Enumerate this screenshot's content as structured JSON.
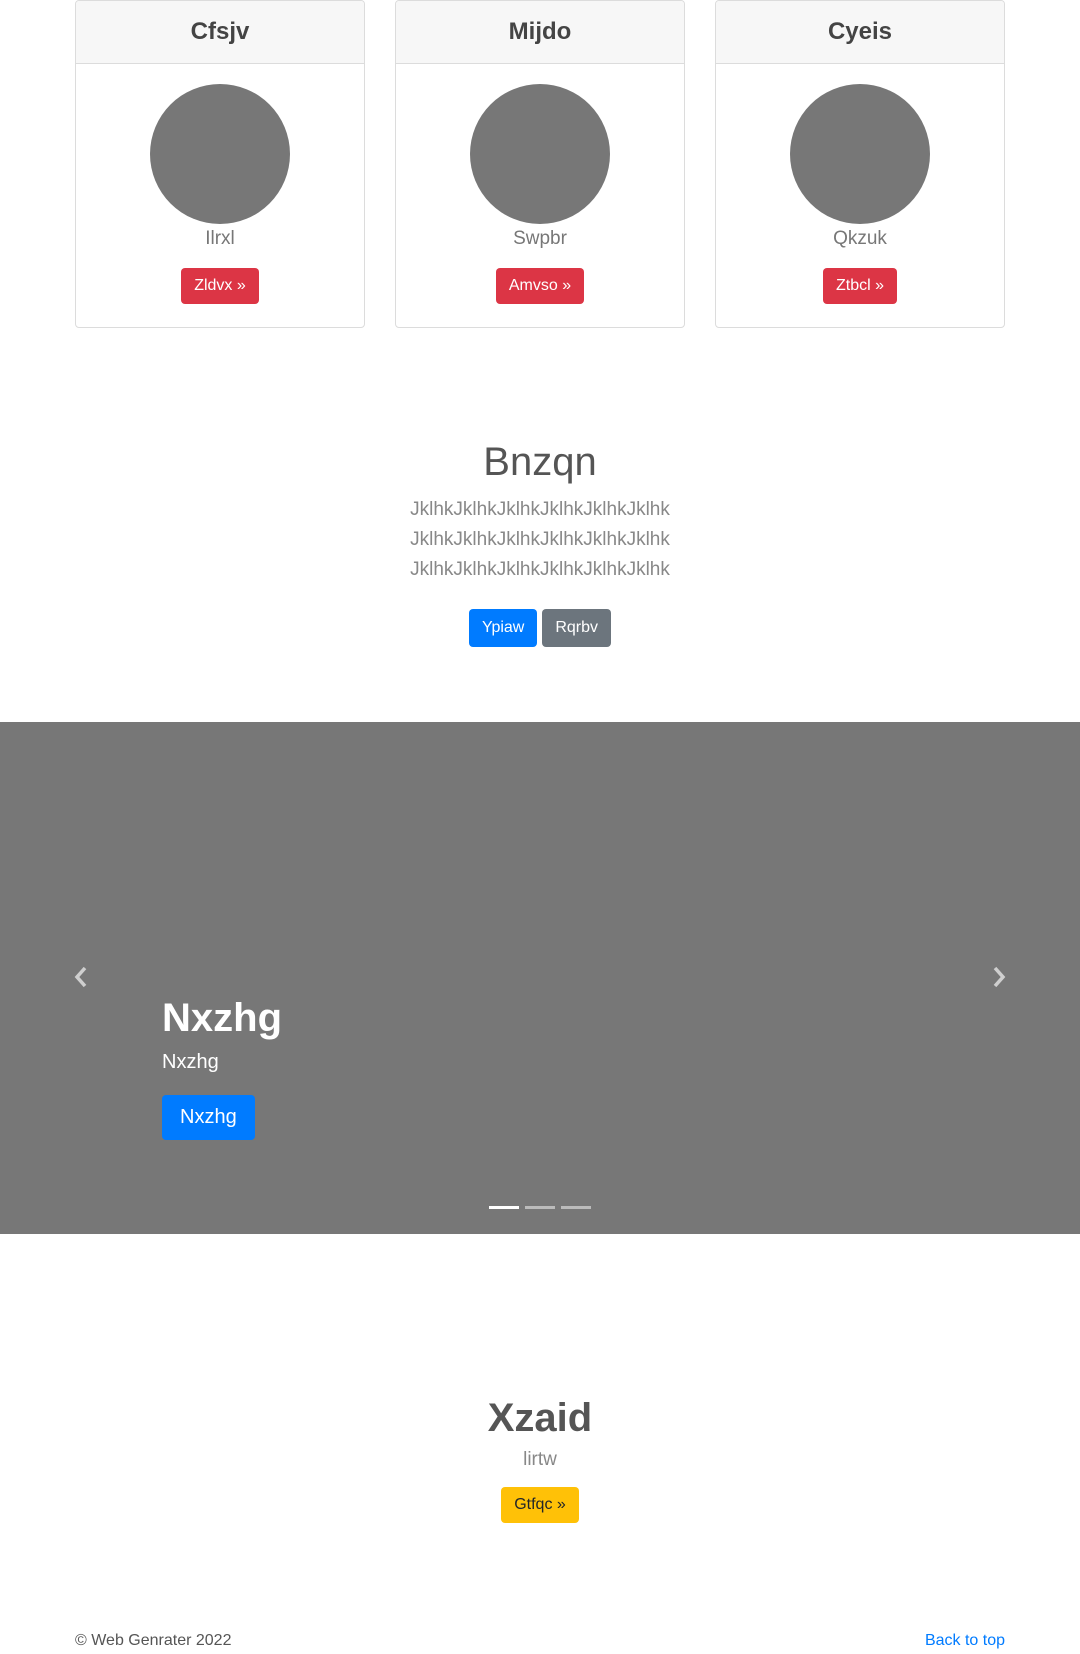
{
  "cards": [
    {
      "title": "Cfsjv",
      "subtitle": "Ilrxl",
      "button": "Zldvx »"
    },
    {
      "title": "Mijdo",
      "subtitle": "Swpbr",
      "button": "Amvso »"
    },
    {
      "title": "Cyeis",
      "subtitle": "Qkzuk",
      "button": "Ztbcl »"
    }
  ],
  "hero": {
    "title": "Bnzqn",
    "text": "JklhkJklhkJklhkJklhkJklhkJklhk JklhkJklhkJklhkJklhkJklhkJklhk JklhkJklhkJklhkJklhkJklhkJklhk",
    "primary_button": "Ypiaw",
    "secondary_button": "Rqrbv"
  },
  "carousel": {
    "title": "Nxzhg",
    "text": "Nxzhg",
    "button": "Nxzhg",
    "slides": 3,
    "active_slide": 0
  },
  "feature": {
    "title": "Xzaid",
    "subtitle": "lirtw",
    "button": "Gtfqc »"
  },
  "footer": {
    "copyright": "© Web Genrater 2022",
    "back_to_top": "Back to top"
  },
  "colors": {
    "danger": "#dc3545",
    "primary": "#007bff",
    "secondary": "#6c757d",
    "warning": "#ffc107",
    "placeholder_gray": "#777777"
  }
}
